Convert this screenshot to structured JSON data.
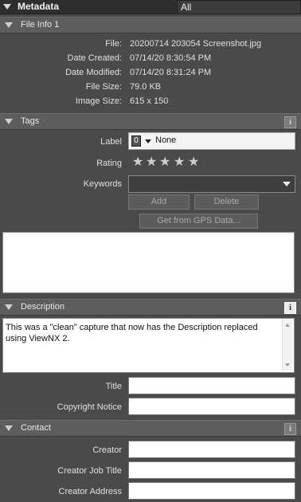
{
  "panel": {
    "title": "Metadata",
    "filter": "All"
  },
  "file_info": {
    "header": "File Info 1",
    "rows": [
      {
        "label": "File:",
        "value": "20200714 203054 Screenshot.jpg"
      },
      {
        "label": "Date Created:",
        "value": "07/14/20 8:30:54 PM"
      },
      {
        "label": "Date Modified:",
        "value": "07/14/20 8:31:24 PM"
      },
      {
        "label": "File Size:",
        "value": "79.0 KB"
      },
      {
        "label": "Image Size:",
        "value": "615 x 150"
      }
    ]
  },
  "tags": {
    "header": "Tags",
    "label_field": {
      "label": "Label",
      "badge": "0",
      "value": "None"
    },
    "rating": {
      "label": "Rating",
      "stars": 5,
      "value": 0
    },
    "keywords": {
      "label": "Keywords",
      "value": ""
    },
    "add_label": "Add",
    "delete_label": "Delete",
    "gps_label": "Get from GPS Data..."
  },
  "description": {
    "header": "Description",
    "text": "This was a \"clean\" capture that now has the Description replaced using ViewNX 2.",
    "title_label": "Title",
    "title_value": "",
    "copyright_label": "Copyright Notice",
    "copyright_value": ""
  },
  "contact": {
    "header": "Contact",
    "creator_label": "Creator",
    "creator_job_label": "Creator Job Title",
    "creator_address_label": "Creator Address"
  }
}
